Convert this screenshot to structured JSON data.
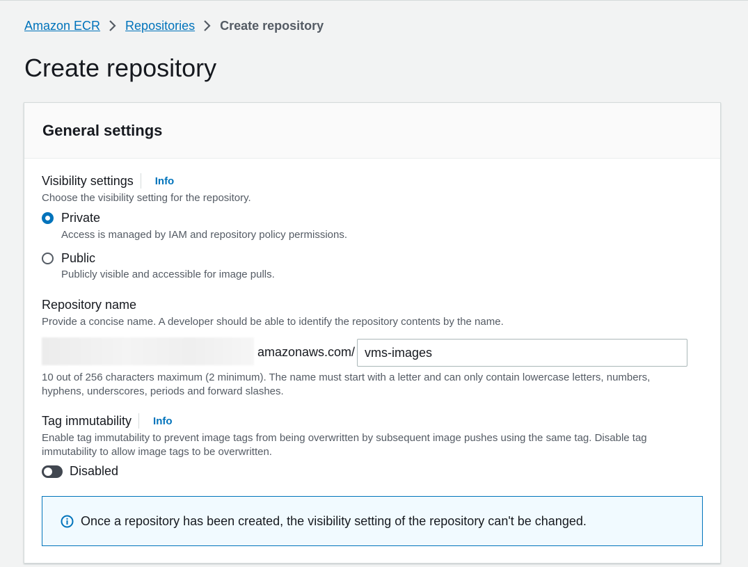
{
  "breadcrumb": {
    "items": [
      "Amazon ECR",
      "Repositories"
    ],
    "current": "Create repository"
  },
  "page": {
    "title": "Create repository"
  },
  "general_settings": {
    "title": "General settings",
    "visibility": {
      "label": "Visibility settings",
      "info": "Info",
      "description": "Choose the visibility setting for the repository.",
      "options": [
        {
          "label": "Private",
          "description": "Access is managed by IAM and repository policy permissions.",
          "selected": true
        },
        {
          "label": "Public",
          "description": "Publicly visible and accessible for image pulls.",
          "selected": false
        }
      ]
    },
    "repository_name": {
      "label": "Repository name",
      "description": "Provide a concise name. A developer should be able to identify the repository contents by the name.",
      "prefix_suffix": "amazonaws.com/",
      "value": "vms-images",
      "constraint_line1": "10 out of 256 characters maximum (2 minimum). The name must start with a letter and can only contain lowercase letters, numbers,",
      "constraint_line2": "hyphens, underscores, periods and forward slashes."
    },
    "tag_immutability": {
      "label": "Tag immutability",
      "info": "Info",
      "description_line1": "Enable tag immutability to prevent image tags from being overwritten by subsequent image pushes using the same tag. Disable tag",
      "description_line2": "immutability to allow image tags to be overwritten.",
      "toggle_label": "Disabled",
      "enabled": false
    },
    "alert": {
      "text": "Once a repository has been created, the visibility setting of the repository can't be changed."
    }
  },
  "colors": {
    "link": "#0073bb",
    "background": "#f2f3f3",
    "panel_header": "#fafafa",
    "alert_bg": "#f1faff",
    "toggle_off": "#414750"
  }
}
